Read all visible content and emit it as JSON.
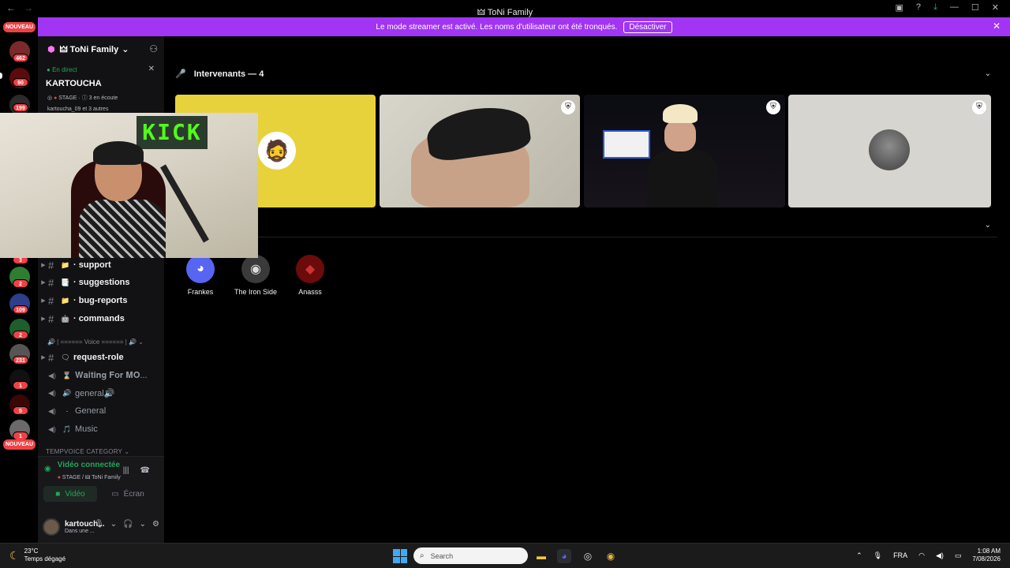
{
  "titlebar": {
    "title": "🜲 ToNi Family",
    "back": "←",
    "forward": "→"
  },
  "banner": {
    "message": "Le mode streamer est activé. Les noms d'utilisateur ont été tronqués.",
    "button": "Désactiver"
  },
  "rail": {
    "new_top": "NOUVEAU",
    "new_bottom": "NOUVEAU",
    "badges": [
      "462",
      "90",
      "199",
      "3",
      "2",
      "109",
      "2",
      "231",
      "1",
      "5",
      "1"
    ]
  },
  "server": {
    "name": "🜲 ToNi Family"
  },
  "live": {
    "status": "En direct",
    "host": "KARTOUCHA",
    "stage": "STAGE",
    "listening": "3 en écoute",
    "others": "kartoucha_09 et 3 autres"
  },
  "channels": [
    {
      "icon": "📁",
      "label": "support"
    },
    {
      "icon": "📑",
      "label": "suggestions"
    },
    {
      "icon": "📁",
      "label": "bug-reports"
    },
    {
      "icon": "🤖",
      "label": "commands"
    }
  ],
  "voice_separator": "🔊 | ====== Voice ====== | 🔊",
  "request_role": {
    "icon": "🗨",
    "label": "request-role"
  },
  "voice_channels": [
    {
      "icon": "⌛",
      "label": "𝐖𝐚𝐢𝐭𝐢𝐧𝐠 𝐅𝐨𝐫 𝐌𝐎..."
    },
    {
      "icon": "🔊",
      "label": "general🔊"
    },
    {
      "icon": "·",
      "label": "General"
    },
    {
      "icon": "🎵",
      "label": "Music"
    }
  ],
  "tempvoice_category": "TEMPVOICE CATEGORY",
  "voice_panel": {
    "status": "Vidéo connectée",
    "location": "STAGE / 🜲 ToNi Family",
    "video_label": "Vidéo",
    "screen_label": "Écran"
  },
  "user": {
    "name": "kartouch...",
    "status": "Dans une ..."
  },
  "stage": {
    "speakers_header": "Intervenants — 4",
    "audience": [
      {
        "name": "Frankes",
        "color": "#5865f2"
      },
      {
        "name": "The Iron Side",
        "color": "#3a3a3a"
      },
      {
        "name": "Anasss",
        "color": "#6b0b0b"
      }
    ]
  },
  "webcam": {
    "sign": "KICK"
  },
  "taskbar": {
    "temp": "23°C",
    "weather": "Temps dégagé",
    "search_placeholder": "Search",
    "lang": "FRA",
    "time": "1:08 AM",
    "date": "7/08/2026"
  },
  "colors": {
    "accent": "#a135f3",
    "online": "#23a55a",
    "badge": "#ed4245"
  }
}
